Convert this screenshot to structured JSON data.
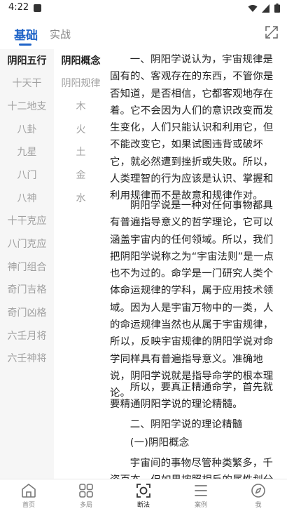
{
  "status_bar": {
    "time": "4:22"
  },
  "tabs": [
    {
      "label": "基础",
      "active": true
    },
    {
      "label": "实战",
      "active": false
    }
  ],
  "categories": [
    {
      "label": "阴阳五行",
      "active": true
    },
    {
      "label": "十天干"
    },
    {
      "label": "十二地支"
    },
    {
      "label": "八卦"
    },
    {
      "label": "九星"
    },
    {
      "label": "八门"
    },
    {
      "label": "八神"
    },
    {
      "label": "十干克应"
    },
    {
      "label": "八门克应"
    },
    {
      "label": "神门组合"
    },
    {
      "label": "奇门吉格"
    },
    {
      "label": "奇门凶格"
    },
    {
      "label": "六壬月将"
    },
    {
      "label": "六壬神将"
    }
  ],
  "subcategories": [
    {
      "label": "阴阳概念",
      "active": true
    },
    {
      "label": "阴阳规律"
    },
    {
      "label": "木"
    },
    {
      "label": "火"
    },
    {
      "label": "土"
    },
    {
      "label": "金"
    },
    {
      "label": "水"
    }
  ],
  "article": {
    "p1": "一、阴阳学说认为，宇宙规律是固有的、客观存在的东西，不管你是否知道，是否相信，它都客观地存在着。它不会因为人们的意识改变而发生变化，人们只能认识和利用它，但不能改变它，如果试图违背或破坏它，就必然遭到挫折或失败。所以，人类理智的行为应该是认识、掌握和利用规律而不是故意和规律作对。",
    "p2": "阴阳学说是一种对任何事物都具有普遍指导意义的哲学理论，它可以涵盖宇宙内的任何领域。所以，我们把阴阳学说称之为“宇宙法则”是一点也不为过的。命学是一门研究人类个体命运规律的学科，属于应用技术领域。因为人是宇宙万物中的一类，人的命运规律当然也从属于宇宙规律，所以，反映宇宙规律的阴阳学说对命学同样具有普遍指导意义。准确地说，阴阳学说就是指导命学的根本理论。",
    "p3": "所以，要真正精通命学，首先就要精通阴阳学说的理论精髓。",
    "p4": "二、阴阳学说的理论精髓",
    "p5": "(一)阴阳概念",
    "p6": "宇宙间的事物尽管种类繁多，千姿百态，但如果按照相反的属性划分"
  },
  "bottom_nav": [
    {
      "label": "首页",
      "icon": "home-icon"
    },
    {
      "label": "多局",
      "icon": "grid-icon"
    },
    {
      "label": "断法",
      "icon": "scan-icon",
      "active": true
    },
    {
      "label": "案例",
      "icon": "list-icon"
    },
    {
      "label": "我",
      "icon": "compass-icon"
    }
  ],
  "colors": {
    "accent": "#1f64c8",
    "inactive_text": "#a0a0a0",
    "left_bg": "#f6f6f6"
  }
}
